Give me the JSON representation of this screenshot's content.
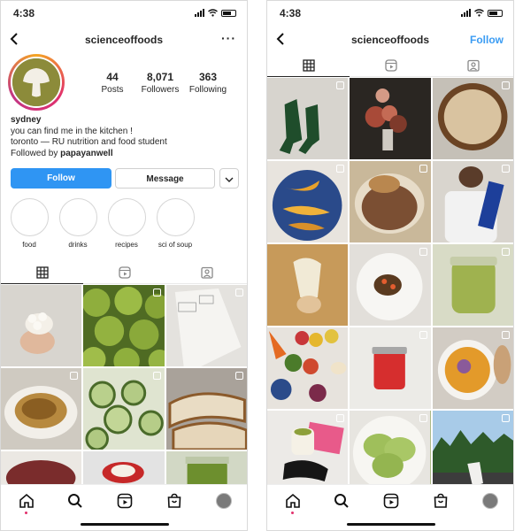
{
  "left_screen": {
    "status": {
      "time": "4:38"
    },
    "header": {
      "username": "scienceoffoods",
      "more_label": "···"
    },
    "stats": [
      {
        "count": "44",
        "label": "Posts"
      },
      {
        "count": "8,071",
        "label": "Followers"
      },
      {
        "count": "363",
        "label": "Following"
      }
    ],
    "bio": {
      "name": "sydney",
      "line1": "you can find me in the kitchen !",
      "line2": "toronto — RU nutrition and food student",
      "followed_prefix": "Followed by ",
      "followed_user": "papayanwell"
    },
    "buttons": {
      "follow": "Follow",
      "message": "Message"
    },
    "highlights": [
      "food",
      "drinks",
      "recipes",
      "sci of soup"
    ]
  },
  "right_screen": {
    "status": {
      "time": "4:38"
    },
    "header": {
      "username": "scienceoffoods",
      "follow_label": "Follow"
    }
  },
  "icons": [
    "back-chevron-icon",
    "more-icon",
    "grid-icon",
    "reels-icon",
    "tagged-icon",
    "home-icon",
    "search-icon",
    "reels-nav-icon",
    "shop-icon",
    "profile-icon",
    "multiple-posts-icon",
    "chevron-down-icon"
  ],
  "colors": {
    "accent": "#2f95f3",
    "link": "#3b9cf3",
    "text": "#262626",
    "notification": "#e1306c"
  }
}
